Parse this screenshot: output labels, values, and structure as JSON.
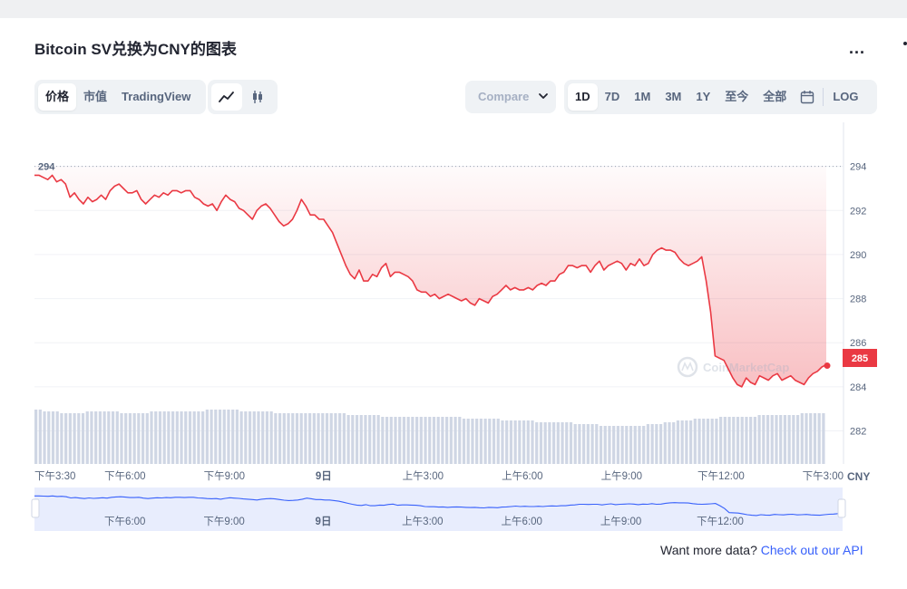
{
  "page": {
    "title": "Bitcoin SV兑换为CNY的图表",
    "more_label": "..."
  },
  "tabs": {
    "price_label": "价格",
    "marketcap_label": "市值",
    "tradingview_label": "TradingView",
    "active": "价格"
  },
  "chart_type_icons": [
    "line-chart-icon",
    "candlestick-icon"
  ],
  "compare": {
    "label": "Compare",
    "placeholder": "Compare"
  },
  "timeframes": {
    "items": [
      "1D",
      "7D",
      "1M",
      "3M",
      "1Y",
      "至今",
      "全部"
    ],
    "active": "1D",
    "calendar_icon": "calendar-icon",
    "log_label": "LOG"
  },
  "watermark": "CoinMarketCap",
  "chart_data": {
    "type": "area",
    "title": "Bitcoin SV兑换为CNY的图表",
    "currency": "CNY",
    "ylim": [
      280.5,
      296
    ],
    "yticks": [
      282,
      284,
      286,
      288,
      290,
      292,
      294
    ],
    "ref_line_value": 294,
    "ref_line_label": "294",
    "current_value": 285,
    "current_label": "285",
    "grid": true,
    "line_color": "#ea3943",
    "x_ticks": [
      {
        "pos": 0.0,
        "label": "下午3:30"
      },
      {
        "pos": 0.114,
        "label": "下午6:00"
      },
      {
        "pos": 0.239,
        "label": "下午9:00"
      },
      {
        "pos": 0.364,
        "label": "9日"
      },
      {
        "pos": 0.489,
        "label": "上午3:00"
      },
      {
        "pos": 0.614,
        "label": "上午6:00"
      },
      {
        "pos": 0.739,
        "label": "上午9:00"
      },
      {
        "pos": 0.864,
        "label": "下午12:00"
      },
      {
        "pos": 0.989,
        "label": "下午3:00"
      }
    ],
    "series": [
      {
        "values": [
          293.6,
          293.6,
          293.5,
          293.4,
          293.6,
          293.3,
          293.4,
          293.2,
          292.6,
          292.8,
          292.5,
          292.3,
          292.6,
          292.4,
          292.5,
          292.7,
          292.5,
          292.9,
          293.1,
          293.2,
          293.0,
          292.8,
          292.8,
          292.9,
          292.5,
          292.3,
          292.5,
          292.7,
          292.6,
          292.8,
          292.7,
          292.9,
          292.9,
          292.8,
          292.9,
          292.9,
          292.6,
          292.5,
          292.3,
          292.2,
          292.3,
          292.0,
          292.4,
          292.7,
          292.5,
          292.4,
          292.1,
          292.0,
          291.8,
          291.6,
          292.0,
          292.2,
          292.3,
          292.1,
          291.8,
          291.5,
          291.3,
          291.4,
          291.6,
          292.0,
          292.5,
          292.2,
          291.8,
          291.8,
          291.6,
          291.6,
          291.3,
          291.0,
          290.5,
          290.0,
          289.5,
          289.1,
          288.9,
          289.3,
          288.8,
          288.8,
          289.1,
          289.0,
          289.4,
          289.6,
          289.0,
          289.2,
          289.2,
          289.1,
          289.0,
          288.8,
          288.4,
          288.3,
          288.3,
          288.1,
          288.2,
          288.0,
          288.1,
          288.2,
          288.1,
          288.0,
          287.9,
          288.0,
          287.8,
          287.7,
          288.0,
          287.9,
          287.8,
          288.1,
          288.2,
          288.4,
          288.6,
          288.4,
          288.5,
          288.4,
          288.4,
          288.5,
          288.4,
          288.6,
          288.7,
          288.6,
          288.8,
          288.8,
          289.1,
          289.2,
          289.5,
          289.5,
          289.4,
          289.5,
          289.5,
          289.2,
          289.5,
          289.7,
          289.3,
          289.5,
          289.6,
          289.7,
          289.6,
          289.3,
          289.6,
          289.5,
          289.8,
          289.5,
          289.6,
          290.0,
          290.2,
          290.3,
          290.2,
          290.2,
          290.1,
          289.8,
          289.6,
          289.5,
          289.6,
          289.7,
          289.9,
          288.8,
          287.4,
          285.4,
          285.3,
          285.2,
          284.8,
          284.4,
          284.1,
          284.0,
          284.4,
          284.2,
          284.1,
          284.5,
          284.4,
          284.3,
          284.5,
          284.6,
          284.3,
          284.4,
          284.5,
          284.3,
          284.2,
          284.1,
          284.4,
          284.6,
          284.7,
          284.9,
          285.0
        ]
      }
    ],
    "volume": [
      30,
      30,
      29,
      29,
      29,
      29,
      28,
      28,
      28,
      28,
      28,
      28,
      29,
      29,
      29,
      29,
      29,
      29,
      29,
      29,
      28,
      28,
      28,
      28,
      28,
      28,
      28,
      29,
      29,
      29,
      29,
      29,
      29,
      29,
      29,
      29,
      29,
      29,
      29,
      29,
      30,
      30,
      30,
      30,
      30,
      30,
      30,
      30,
      29,
      29,
      29,
      29,
      29,
      29,
      29,
      29,
      28,
      28,
      28,
      28,
      28,
      28,
      28,
      28,
      28,
      28,
      28,
      28,
      28,
      28,
      28,
      28,
      28,
      27,
      27,
      27,
      27,
      27,
      27,
      27,
      27,
      26,
      26,
      26,
      26,
      26,
      26,
      26,
      26,
      26,
      26,
      26,
      26,
      26,
      26,
      26,
      26,
      26,
      26,
      26,
      25,
      25,
      25,
      25,
      25,
      25,
      25,
      25,
      25,
      24,
      24,
      24,
      24,
      24,
      24,
      24,
      24,
      23,
      23,
      23,
      23,
      23,
      23,
      23,
      23,
      23,
      22,
      22,
      22,
      22,
      22,
      22,
      21,
      21,
      21,
      21,
      21,
      21,
      21,
      21,
      21,
      21,
      21,
      22,
      22,
      22,
      22,
      23,
      23,
      23,
      24,
      24,
      24,
      24,
      25,
      25,
      25,
      25,
      25,
      25,
      26,
      26,
      26,
      26,
      26,
      26,
      26,
      26,
      26,
      27,
      27,
      27,
      27,
      27,
      27,
      27,
      27,
      27,
      27,
      28,
      28,
      28,
      28,
      28,
      28
    ],
    "navigator": {
      "labels": [
        {
          "pos": 0.114,
          "label": "下午6:00"
        },
        {
          "pos": 0.239,
          "label": "下午9:00"
        },
        {
          "pos": 0.364,
          "label": "9日"
        },
        {
          "pos": 0.489,
          "label": "上午3:00"
        },
        {
          "pos": 0.614,
          "label": "上午6:00"
        },
        {
          "pos": 0.739,
          "label": "上午9:00"
        },
        {
          "pos": 0.864,
          "label": "下午12:00"
        }
      ]
    }
  },
  "footer": {
    "prefix": "Want more data?",
    "link_label": "Check out our API"
  }
}
